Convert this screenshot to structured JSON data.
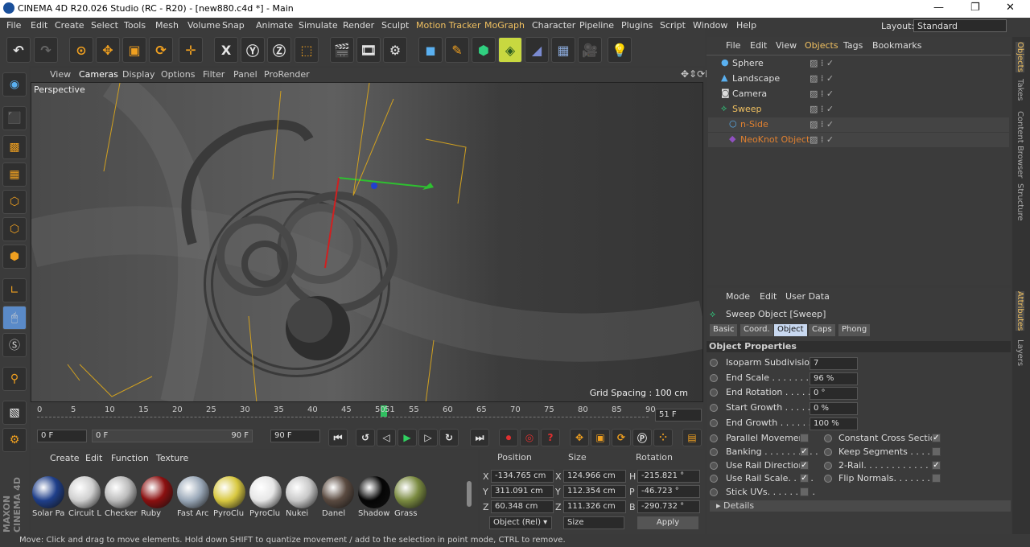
{
  "window": {
    "title": "CINEMA 4D R20.026 Studio (RC - R20) - [new880.c4d *] - Main"
  },
  "menu": [
    "File",
    "Edit",
    "Create",
    "Select",
    "Tools",
    "Mesh",
    "Volume",
    "Snap",
    "Animate",
    "Simulate",
    "Render",
    "Sculpt",
    "Motion Tracker",
    "MoGraph",
    "Character",
    "Pipeline",
    "Plugins",
    "Script",
    "Window",
    "Help"
  ],
  "layout": {
    "label": "Layout:",
    "value": "Standard"
  },
  "viewport": {
    "menu": [
      "View",
      "Cameras",
      "Display",
      "Options",
      "Filter",
      "Panel",
      "ProRender"
    ],
    "label": "Perspective",
    "grid": "Grid Spacing : 100 cm"
  },
  "timeline": {
    "ticks": [
      "0",
      "5",
      "10",
      "15",
      "20",
      "25",
      "30",
      "35",
      "40",
      "45",
      "50",
      "51",
      "55",
      "60",
      "65",
      "70",
      "75",
      "80",
      "85",
      "90"
    ],
    "current": "51 F",
    "progress": 0.567
  },
  "transport": {
    "start": "0 F",
    "min": "0 F",
    "max": "90 F",
    "end": "90 F"
  },
  "materials": {
    "menu": [
      "Create",
      "Edit",
      "Function",
      "Texture"
    ],
    "items": [
      {
        "name": "Solar Pa",
        "color": "#1f3f8a"
      },
      {
        "name": "Circuit L",
        "color": "#cfcfcf"
      },
      {
        "name": "Checker",
        "color": "#bbbbbb"
      },
      {
        "name": "Ruby",
        "color": "#8b1010"
      },
      {
        "name": "Fast Arc",
        "color": "#9aa8b8"
      },
      {
        "name": "PyroClu",
        "color": "#d8c840"
      },
      {
        "name": "PyroClu",
        "color": "#e6e6e6"
      },
      {
        "name": "Nukei",
        "color": "#c8c8c8"
      },
      {
        "name": "Danel",
        "color": "#5a4a40"
      },
      {
        "name": "Shadow",
        "color": "#050505"
      },
      {
        "name": "Grass",
        "color": "#7a8a40"
      }
    ]
  },
  "coords": {
    "headers": [
      "Position",
      "Size",
      "Rotation"
    ],
    "rows": [
      {
        "axis": "X",
        "pos": "-134.765 cm",
        "saxis": "X",
        "size": "124.966 cm",
        "raxis": "H",
        "rot": "-215.821 °"
      },
      {
        "axis": "Y",
        "pos": "311.091 cm",
        "saxis": "Y",
        "size": "112.354 cm",
        "raxis": "P",
        "rot": "-46.723 °"
      },
      {
        "axis": "Z",
        "pos": "60.348 cm",
        "saxis": "Z",
        "size": "111.326 cm",
        "raxis": "B",
        "rot": "-290.732 °"
      }
    ],
    "mode": "Object (Rel)",
    "sizemode": "Size",
    "apply": "Apply"
  },
  "objects": {
    "menu": [
      "File",
      "Edit",
      "View",
      "Objects",
      "Tags",
      "Bookmarks"
    ],
    "items": [
      {
        "name": "Sphere",
        "color": "#ddd"
      },
      {
        "name": "Landscape",
        "color": "#ddd"
      },
      {
        "name": "Camera",
        "color": "#ddd"
      },
      {
        "name": "Sweep",
        "color": "#f0c060"
      },
      {
        "name": "n-Side",
        "color": "#e08030"
      },
      {
        "name": "NeoKnot Object",
        "color": "#e08030"
      }
    ]
  },
  "attributes": {
    "menu": [
      "Mode",
      "Edit",
      "User Data"
    ],
    "title": "Sweep Object [Sweep]",
    "tabs": [
      "Basic",
      "Coord.",
      "Object",
      "Caps",
      "Phong"
    ],
    "section": "Object Properties",
    "props": [
      {
        "label": "Isoparm Subdivision",
        "value": "7"
      },
      {
        "label": "End Scale . . . . . . . . . . .",
        "value": "96 %"
      },
      {
        "label": "End Rotation . . . . . . .",
        "value": "0 °"
      },
      {
        "label": "Start Growth . . . . . . .",
        "value": "0 %"
      },
      {
        "label": "End Growth . . . . . . . .",
        "value": "100 %"
      }
    ],
    "checks_left": [
      {
        "label": "Parallel Movement",
        "checked": false
      },
      {
        "label": "Banking . . . . . . . . . .",
        "checked": true
      },
      {
        "label": "Use Rail Direction",
        "checked": true
      },
      {
        "label": "Use Rail Scale. . . . .",
        "checked": true
      },
      {
        "label": "Stick UVs. . . . . . . . .",
        "checked": false
      }
    ],
    "checks_right": [
      {
        "label": "Constant Cross Section",
        "checked": true
      },
      {
        "label": "Keep Segments . . . . . .",
        "checked": false
      },
      {
        "label": "2-Rail. . . . . . . . . . . . . .",
        "checked": true
      },
      {
        "label": "Flip Normals. . . . . . . . .",
        "checked": false
      }
    ],
    "details": "Details"
  },
  "sidetabs": [
    "Objects",
    "Takes",
    "Content Browser",
    "Structure",
    "Attributes",
    "Layers"
  ],
  "status": "Move: Click and drag to move elements. Hold down SHIFT to quantize movement / add to the selection in point mode, CTRL to remove.",
  "brand": "MAXON CINEMA 4D"
}
